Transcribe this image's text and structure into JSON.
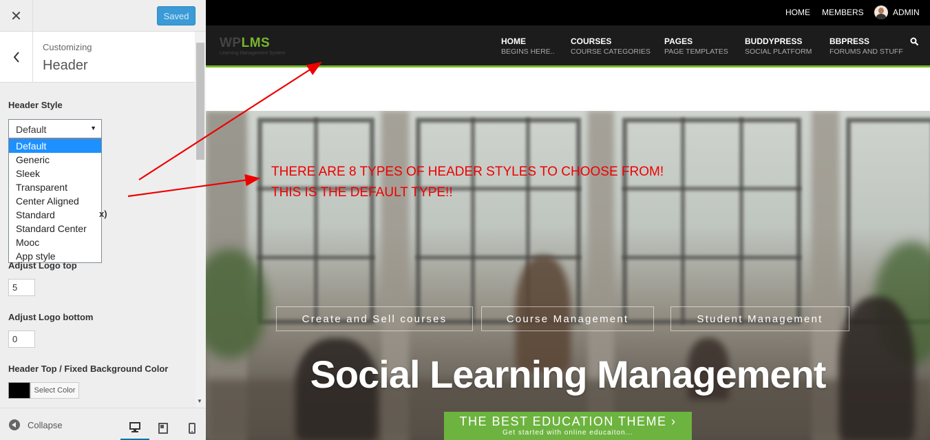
{
  "sidebar": {
    "close_icon": "close-icon",
    "saved_label": "Saved",
    "customizing_label": "Customizing",
    "section_title": "Header",
    "header_style": {
      "label": "Header Style",
      "value": "Default",
      "options": [
        "Default",
        "Generic",
        "Sleek",
        "Transparent",
        "Center Aligned",
        "Standard",
        "Standard Center",
        "Mooc",
        "App style"
      ]
    },
    "hidden_label_tail": "x)",
    "logo_top": {
      "label": "Adjust Logo top",
      "value": "5"
    },
    "logo_bottom": {
      "label": "Adjust Logo bottom",
      "value": "0"
    },
    "bg_color": {
      "label": "Header Top / Fixed Background Color",
      "button": "Select Color",
      "color": "#000000"
    },
    "footer": {
      "collapse_label": "Collapse"
    }
  },
  "preview": {
    "topbar": {
      "links": [
        "HOME",
        "MEMBERS",
        "ADMIN"
      ]
    },
    "logo": {
      "wp": "WP",
      "lms": "LMS",
      "tagline": "Learning Management System"
    },
    "nav": [
      {
        "main": "HOME",
        "sub": "BEGINS HERE.."
      },
      {
        "main": "COURSES",
        "sub": "COURSE CATEGORIES"
      },
      {
        "main": "PAGES",
        "sub": "PAGE TEMPLATES"
      },
      {
        "main": "BUDDYPRESS",
        "sub": "SOCIAL PLATFORM"
      },
      {
        "main": "BBPRESS",
        "sub": "FORUMS AND STUFF"
      }
    ],
    "annotation": {
      "line1": "THERE ARE 8 TYPES OF HEADER STYLES TO CHOOSE FROM!",
      "line2": "THIS IS THE DEFAULT TYPE!!"
    },
    "hero": {
      "pills": [
        "Create and Sell courses",
        "Course Management",
        "Student Management"
      ],
      "title": "Social Learning Management",
      "cta_main": "THE BEST EDUCATION THEME ›",
      "cta_sub": "Get started with online educaiton..."
    }
  },
  "colors": {
    "accent_green": "#78b72d",
    "cta_green": "#6db33f",
    "saved_blue": "#3a9bd6",
    "annotation_red": "#e00000",
    "selected_option": "#1e90ff"
  }
}
